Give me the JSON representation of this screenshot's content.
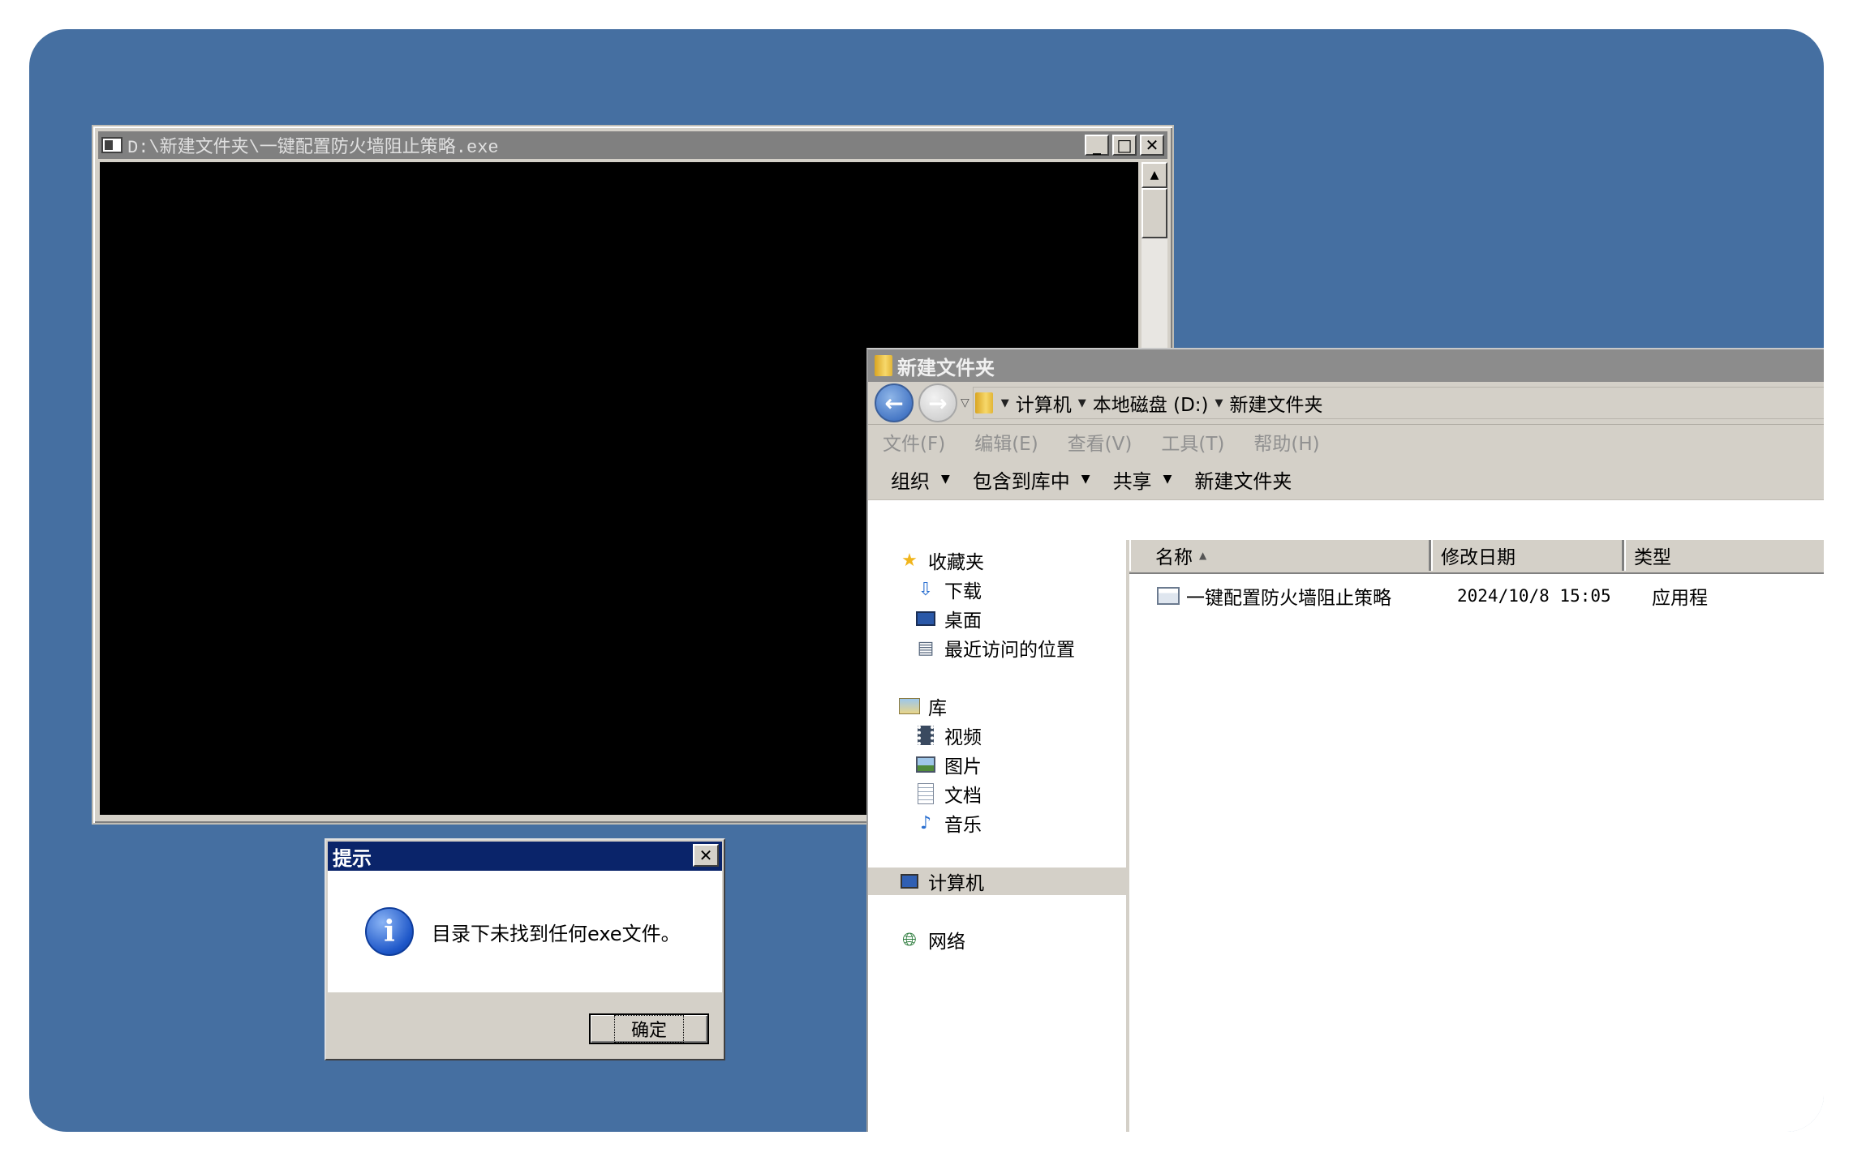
{
  "console_window": {
    "title": "D:\\新建文件夹\\一键配置防火墙阻止策略.exe",
    "min_glyph": "_",
    "max_glyph": "□",
    "close_glyph": "✕",
    "scroll_up_glyph": "▲"
  },
  "explorer": {
    "title": "新建文件夹",
    "address_path": [
      "计算机",
      "本地磁盘 (D:)",
      "新建文件夹"
    ],
    "menu": [
      "文件(F)",
      "编辑(E)",
      "查看(V)",
      "工具(T)",
      "帮助(H)"
    ],
    "toolbar": {
      "organize": "组织",
      "include_library": "包含到库中",
      "share": "共享",
      "new_folder": "新建文件夹"
    },
    "nav": {
      "favorites": "收藏夹",
      "downloads": "下载",
      "desktop": "桌面",
      "recent": "最近访问的位置",
      "libraries": "库",
      "videos": "视频",
      "pictures": "图片",
      "documents": "文档",
      "music": "音乐",
      "computer": "计算机",
      "network": "网络"
    },
    "columns": {
      "name": "名称",
      "date": "修改日期",
      "type": "类型"
    },
    "files": [
      {
        "name": "一键配置防火墙阻止策略",
        "date": "2024/10/8 15:05",
        "type": "应用程"
      }
    ]
  },
  "dialog": {
    "title": "提示",
    "message": "目录下未找到任何exe文件。",
    "ok_label": "确定",
    "close_glyph": "✕",
    "icon_glyph": "i"
  }
}
